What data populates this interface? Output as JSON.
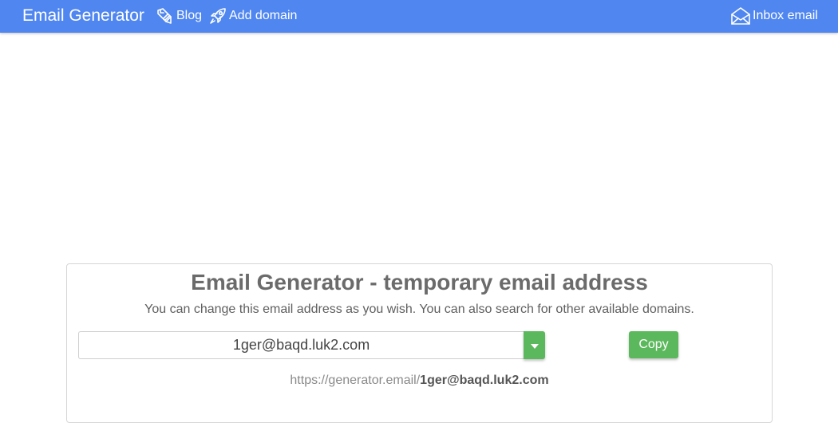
{
  "navbar": {
    "brand": "Email Generator",
    "links": [
      {
        "label": "Blog",
        "icon": "pencil-icon"
      },
      {
        "label": "Add domain",
        "icon": "rocket-icon"
      },
      {
        "label": "Inbox email",
        "icon": "envelope-open-icon"
      }
    ],
    "background": "#4f86f0"
  },
  "main": {
    "title": "Email Generator - temporary email address",
    "subtitle": "You can change this email address as you wish. You can also search for other available domains.",
    "email_value": "1ger@baqd.luk2.com",
    "copy_label": "Copy",
    "url_prefix": "https://generator.email/",
    "url_address": "1ger@baqd.luk2.com",
    "accent": "#5cb85c"
  }
}
